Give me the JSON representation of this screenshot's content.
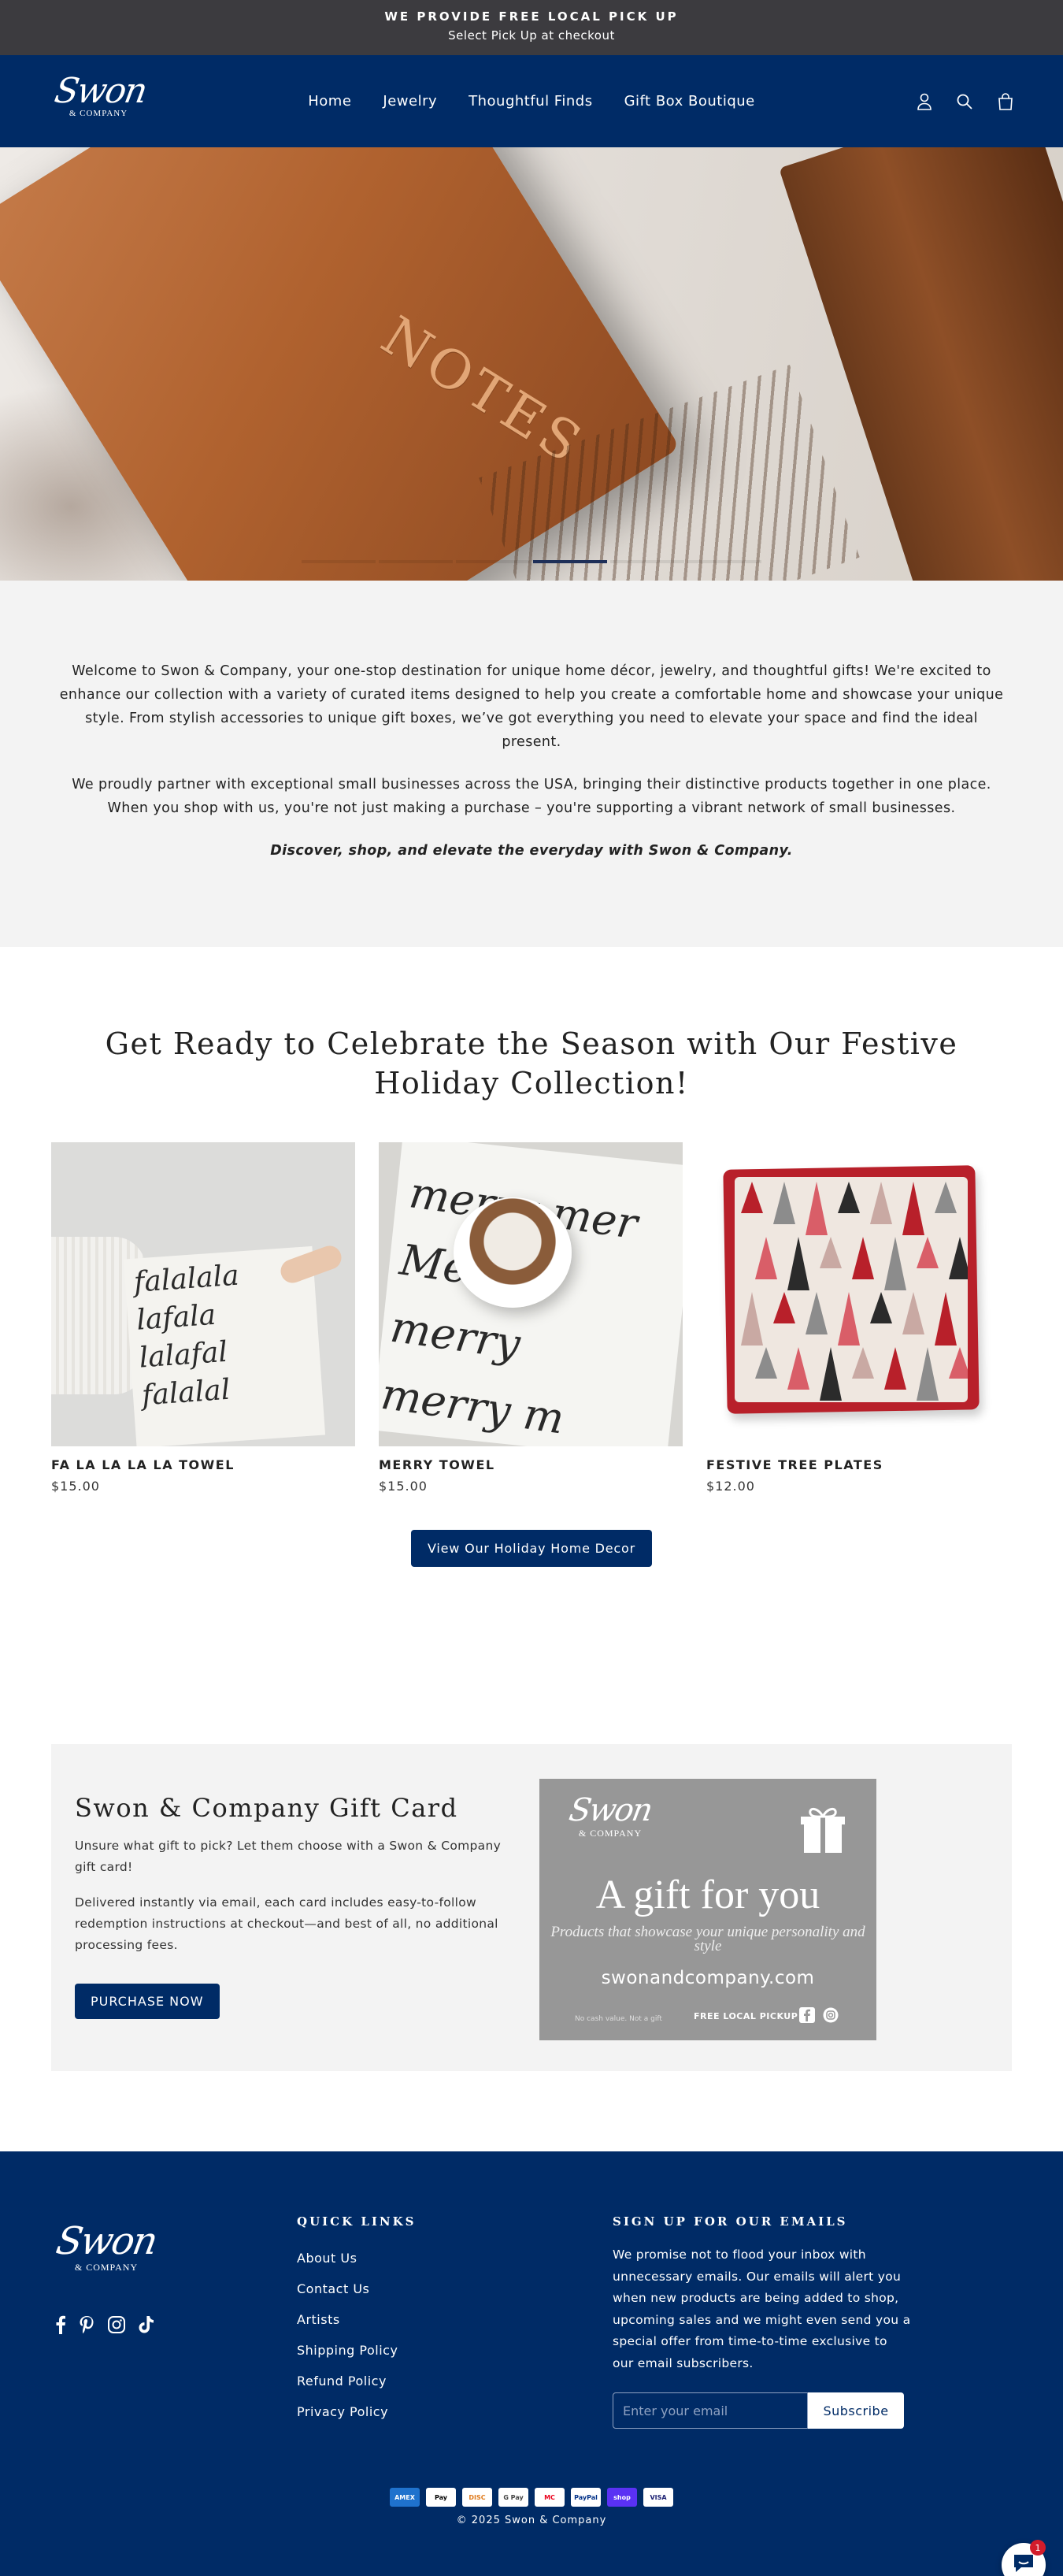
{
  "announcement": {
    "line1": "WE PROVIDE FREE LOCAL PICK UP",
    "line2": "Select Pick Up at checkout"
  },
  "header": {
    "logo_script": "Swon",
    "logo_sub": "& COMPANY",
    "nav": [
      "Home",
      "Jewelry",
      "Thoughtful Finds",
      "Gift Box Boutique"
    ],
    "icons": [
      "account-icon",
      "search-icon",
      "cart-icon"
    ]
  },
  "hero": {
    "book_text": "NOTES",
    "slide_count": 6,
    "active_slide": 4
  },
  "intro": {
    "p1": "Welcome to Swon & Company, your one-stop destination for unique home décor, jewelry, and thoughtful gifts! We're excited to enhance our collection with a variety of curated items designed to help you create a comfortable home and showcase your unique style. From stylish accessories to unique gift boxes, we’ve got everything you need to elevate your space and find the ideal present.",
    "p2": "We proudly partner with exceptional small businesses across the USA, bringing their distinctive products together in one place. When you shop with us, you're not just making a purchase – you're supporting a vibrant network of small businesses.",
    "tagline": "Discover, shop, and elevate the everyday with Swon & Company."
  },
  "holiday": {
    "heading": "Get Ready to Celebrate the Season with Our Festive Holiday Collection!",
    "products": [
      {
        "name": "FA LA LA LA LA TOWEL",
        "price": "$15.00",
        "art_text": "falalala\nlafala\nlalafal\nfalalal"
      },
      {
        "name": "MERRY TOWEL",
        "price": "$15.00",
        "art_text": "merry mer\nMerry\nmerry\nmerry m"
      },
      {
        "name": "FESTIVE TREE PLATES",
        "price": "$12.00"
      }
    ],
    "cta": "View Our Holiday Home Decor"
  },
  "gift_card": {
    "title": "Swon & Company Gift Card",
    "p1": "Unsure what gift to pick? Let them choose with a Swon & Company gift card!",
    "p2": "Delivered instantly via email, each card includes easy-to-follow redemption instructions at checkout—and best of all, no additional processing fees.",
    "button": "PURCHASE NOW",
    "card": {
      "logo_script": "Swon",
      "logo_sub": "& COMPANY",
      "headline": "A gift for you",
      "tagline": "Products that showcase your unique personality and style",
      "url": "swonandcompany.com",
      "small_print": "No cash value. Not a gift",
      "pickup": "FREE LOCAL PICKUP"
    }
  },
  "footer": {
    "logo_script": "Swon",
    "logo_sub": "& COMPANY",
    "social": [
      "facebook-icon",
      "pinterest-icon",
      "instagram-icon",
      "tiktok-icon"
    ],
    "quick_links_title": "QUICK LINKS",
    "quick_links": [
      "About Us",
      "Contact Us",
      "Artists",
      "Shipping Policy",
      "Refund Policy",
      "Privacy Policy"
    ],
    "signup_title": "SIGN UP FOR OUR EMAILS",
    "signup_text": "We promise not to flood your inbox with unnecessary emails. Our emails will alert you when new products are being added to shop, upcoming sales and we might even send you a special offer from time-to-time exclusive to our email subscribers.",
    "email_placeholder": "Enter your email",
    "subscribe": "Subscribe",
    "payments": [
      "AMEX",
      "Pay",
      "DISC",
      "G Pay",
      "MC",
      "PayPal",
      "shop",
      "VISA"
    ],
    "copyright": "© 2025 Swon & Company",
    "chat_badge": "1"
  },
  "colors": {
    "navy": "#002b66",
    "announcement_bg": "#3c3b3f",
    "section_gray": "#f3f3f3",
    "card_gray": "#979797"
  }
}
